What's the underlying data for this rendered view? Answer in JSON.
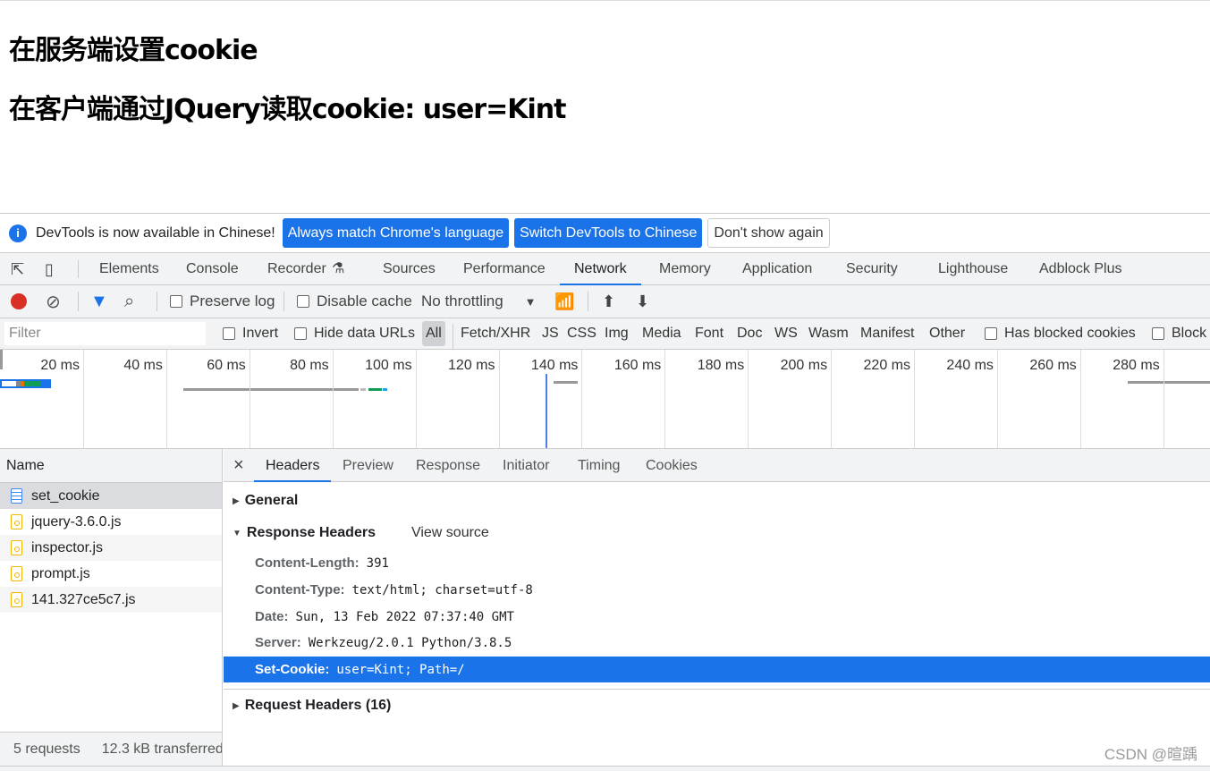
{
  "page": {
    "heading1": "在服务端设置cookie",
    "heading2": "在客户端通过JQuery读取cookie: user=Kint"
  },
  "infobar": {
    "icon": "info-icon",
    "message": "DevTools is now available in Chinese!",
    "btn_match": "Always match Chrome's language",
    "btn_switch": "Switch DevTools to Chinese",
    "btn_dismiss": "Don't show again"
  },
  "tabs": [
    "Elements",
    "Console",
    "Recorder",
    "Sources",
    "Performance",
    "Network",
    "Memory",
    "Application",
    "Security",
    "Lighthouse",
    "Adblock Plus"
  ],
  "active_tab": "Network",
  "toolbar": {
    "preserve_log": "Preserve log",
    "disable_cache": "Disable cache",
    "throttling": "No throttling"
  },
  "filter": {
    "placeholder": "Filter",
    "invert": "Invert",
    "hide_data_urls": "Hide data URLs",
    "types": [
      "All",
      "Fetch/XHR",
      "JS",
      "CSS",
      "Img",
      "Media",
      "Font",
      "Doc",
      "WS",
      "Wasm",
      "Manifest",
      "Other"
    ],
    "has_blocked": "Has blocked cookies",
    "blocked": "Block"
  },
  "timeline": {
    "ticks": [
      "20 ms",
      "40 ms",
      "60 ms",
      "80 ms",
      "100 ms",
      "120 ms",
      "140 ms",
      "160 ms",
      "180 ms",
      "200 ms",
      "220 ms",
      "240 ms",
      "260 ms",
      "280 ms",
      "30"
    ]
  },
  "requests": {
    "header": "Name",
    "items": [
      "set_cookie",
      "jquery-3.6.0.js",
      "inspector.js",
      "prompt.js",
      "141.327ce5c7.js"
    ],
    "footer_count": "5 requests",
    "footer_size": "12.3 kB transferred"
  },
  "details": {
    "close": "×",
    "tabs": [
      "Headers",
      "Preview",
      "Response",
      "Initiator",
      "Timing",
      "Cookies"
    ],
    "general": "General",
    "response_headers": "Response Headers",
    "view_source": "View source",
    "headers": [
      {
        "k": "Content-Length:",
        "v": "391"
      },
      {
        "k": "Content-Type:",
        "v": "text/html; charset=utf-8"
      },
      {
        "k": "Date:",
        "v": "Sun, 13 Feb 2022 07:37:40 GMT"
      },
      {
        "k": "Server:",
        "v": "Werkzeug/2.0.1 Python/3.8.5"
      },
      {
        "k": "Set-Cookie:",
        "v": "user=Kint; Path=/"
      }
    ],
    "request_headers": "Request Headers (16)"
  },
  "watermark": "CSDN @暄踽",
  "colors": {
    "accent": "#1a73e8",
    "record": "#d93025"
  }
}
